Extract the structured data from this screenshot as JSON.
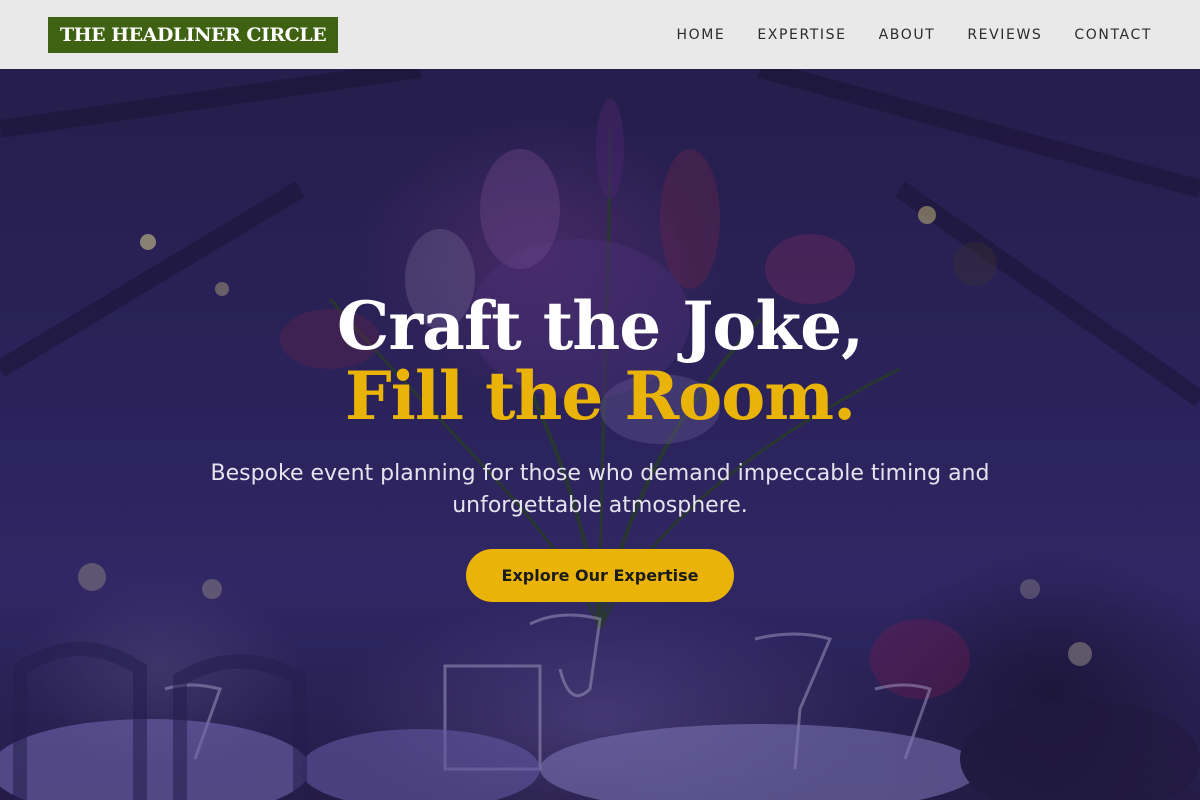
{
  "brand": {
    "name": "THE HEADLINER CIRCLE",
    "color": "#3f6212"
  },
  "nav": {
    "items": [
      {
        "label": "HOME"
      },
      {
        "label": "EXPERTISE"
      },
      {
        "label": "ABOUT"
      },
      {
        "label": "REVIEWS"
      },
      {
        "label": "CONTACT"
      }
    ]
  },
  "hero": {
    "headline_line1": "Craft the Joke,",
    "headline_line2": "Fill the Room.",
    "subtitle": "Bespoke event planning for those who demand impeccable timing and unforgettable atmosphere.",
    "cta_label": "Explore Our Expertise",
    "accent_color": "#eab308",
    "background_image": "purple-lit banquet table with floral centerpiece and glassware"
  }
}
